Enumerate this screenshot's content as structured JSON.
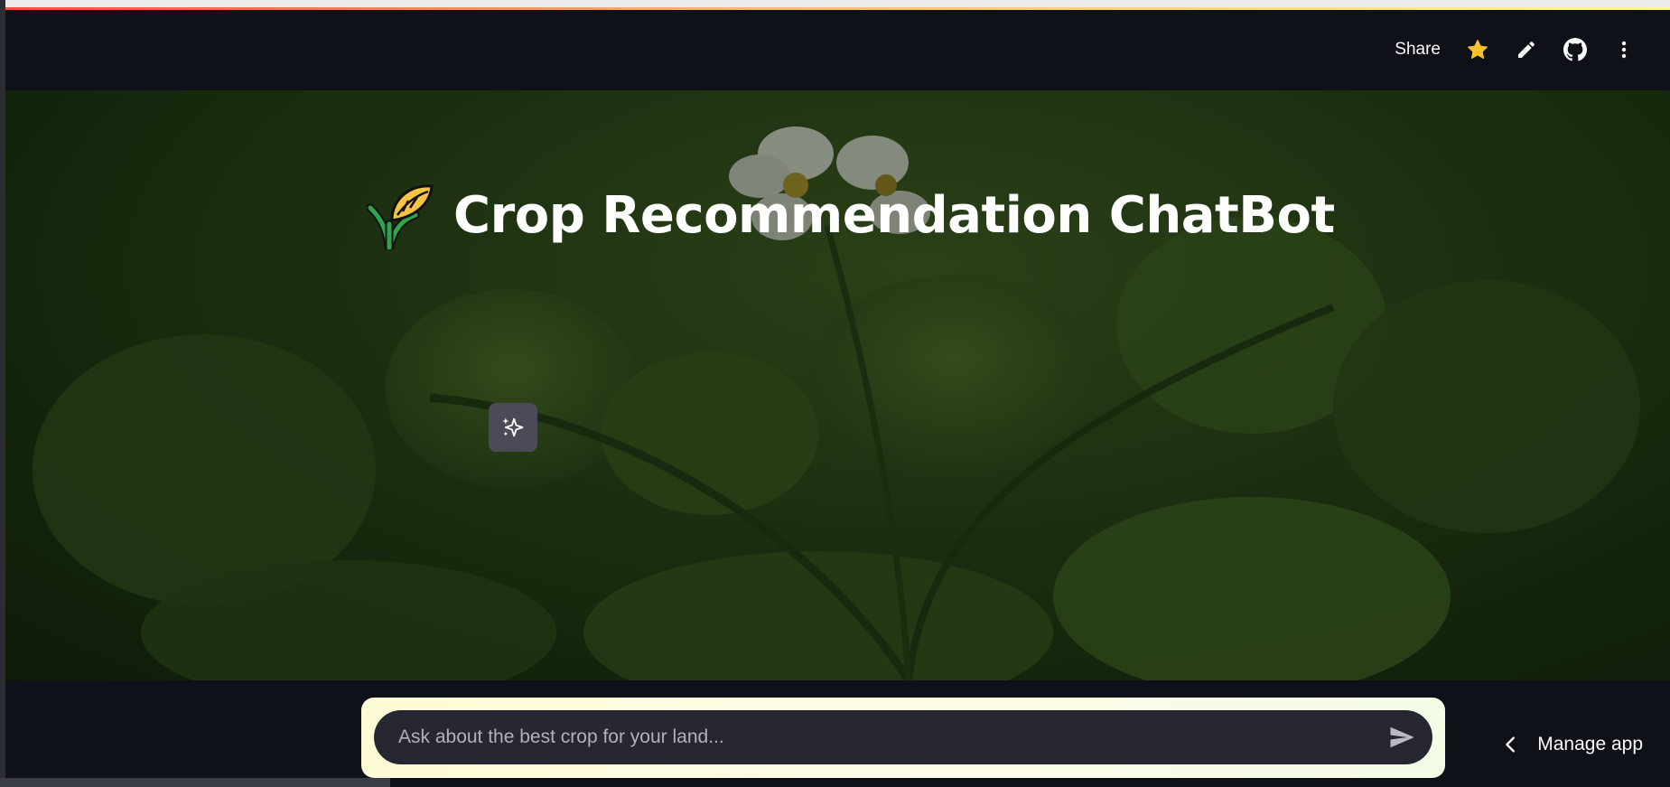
{
  "header": {
    "share_label": "Share",
    "icons": [
      "star-icon",
      "pencil-icon",
      "github-icon",
      "more-vertical-icon"
    ],
    "star_color": "#f7c325"
  },
  "hero": {
    "emoji": "🌾",
    "title": "Crop Recommendation ChatBot",
    "sparkle_icon": "sparkle-icon"
  },
  "chat": {
    "placeholder": "Ask about the best crop for your land...",
    "send_icon": "send-icon"
  },
  "manage_app": {
    "label": "Manage app",
    "icon": "chevron-left-icon"
  },
  "colors": {
    "app_background": "#0e1117",
    "input_background": "#262730",
    "accent_gradient": [
      "#ff4b4b",
      "#fdbb6a",
      "#fffd80"
    ]
  }
}
